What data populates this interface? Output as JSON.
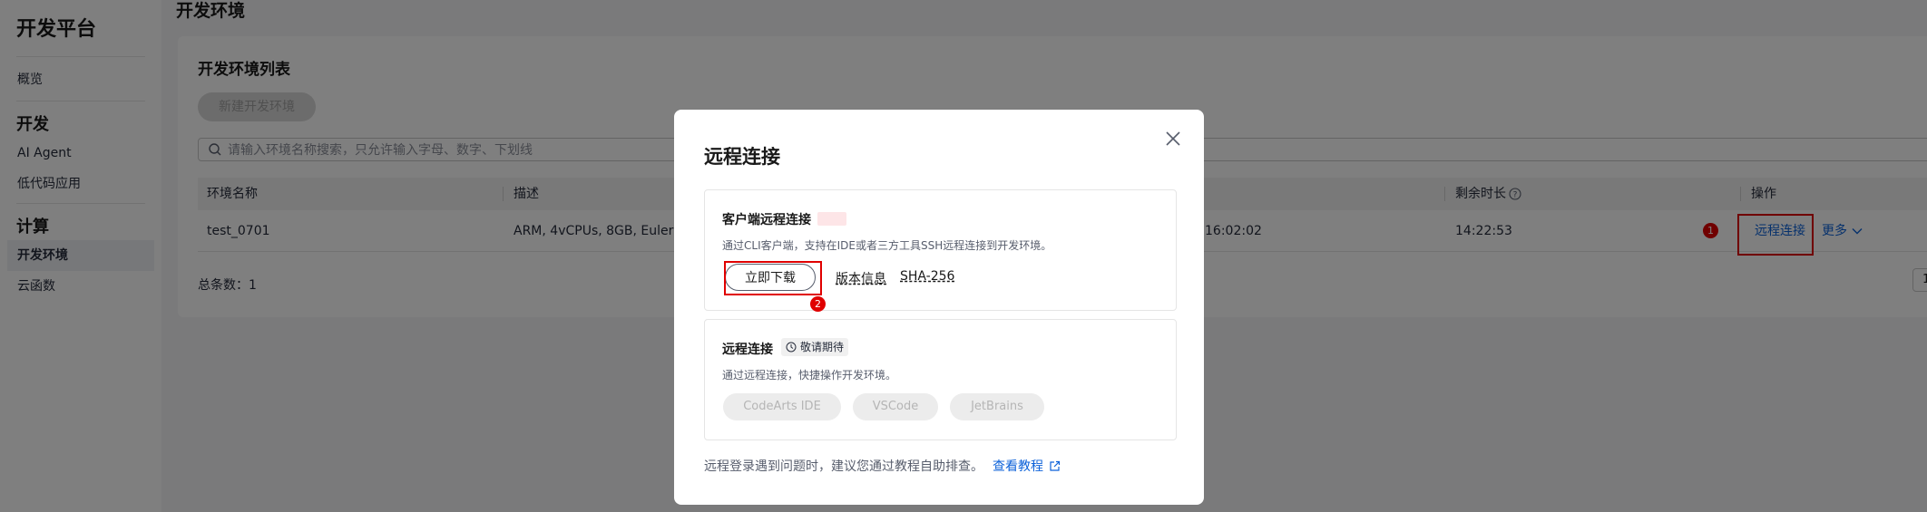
{
  "sidebar": {
    "title": "开发平台",
    "overview": "概览",
    "sections": [
      {
        "title": "开发",
        "items": [
          "AI Agent",
          "低代码应用"
        ]
      },
      {
        "title": "计算",
        "items": [
          "开发环境",
          "云函数"
        ]
      }
    ]
  },
  "main": {
    "title": "开发环境",
    "panel_title": "开发环境列表",
    "new_button": "新建开发环境",
    "search_placeholder": "请输入环境名称搜索，只允许输入字母、数字、下划线",
    "columns": [
      "环境名称",
      "描述",
      "剩余时长",
      "操作"
    ],
    "row": {
      "name": "test_0701",
      "desc": "ARM, 4vCPUs, 8GB, Euler,",
      "time": "16:02:02",
      "remaining": "14:22:53",
      "action_remote": "远程连接",
      "action_more": "更多"
    },
    "total": "总条数：1",
    "page": "1"
  },
  "annotations": {
    "badge1": "1",
    "badge2": "2",
    "color": "#e00000"
  },
  "modal": {
    "title": "远程连接",
    "card1": {
      "title": "客户端远程连接",
      "desc": "通过CLI客户端，支持在IDE或者三方工具SSH远程连接到开发环境。",
      "download": "立即下载",
      "version": "版本信息",
      "sha": "SHA-256"
    },
    "card2": {
      "title": "远程连接",
      "tag": "敬请期待",
      "desc": "通过远程连接，快捷操作开发环境。",
      "pills": [
        "CodeArts IDE",
        "VSCode",
        "JetBrains"
      ]
    },
    "footer_text": "远程登录遇到问题时，建议您通过教程自助排查。",
    "footer_link": "查看教程"
  },
  "colors": {
    "accent": "#0d62d9",
    "overlay": "rgba(0,0,0,0.5)"
  }
}
